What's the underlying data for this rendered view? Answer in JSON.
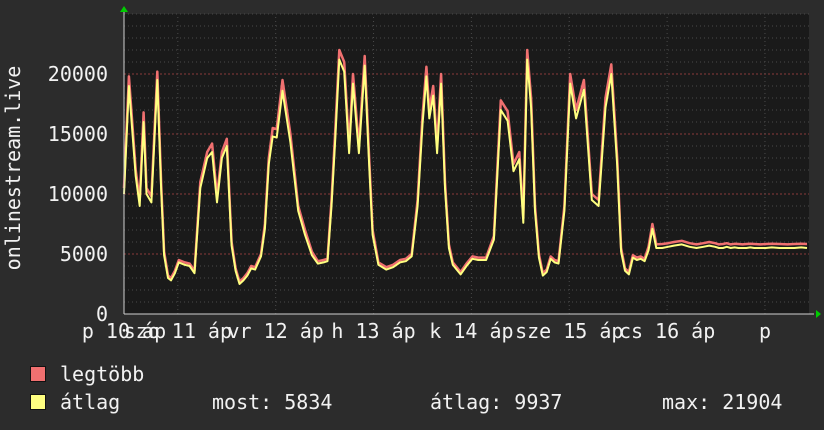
{
  "colors": {
    "background": "#2c2c2c",
    "plot_bg": "#1a1a1a",
    "grid": "#4a4a4a",
    "max_series": "#f07070",
    "avg_series": "#ffff80",
    "axis_arrow": "#00cc00",
    "text": "#f2f2f2"
  },
  "chart_data": {
    "type": "area",
    "ylabel": "onlinestream.live",
    "ylim": [
      0,
      25000
    ],
    "yticks": [
      0,
      5000,
      10000,
      15000,
      20000
    ],
    "ytick_labels": [
      "0",
      "5000",
      "10000",
      "15000",
      "20000"
    ],
    "xlim": [
      0,
      7
    ],
    "xticks": [
      {
        "x": 0.0,
        "label": "p 10 áp"
      },
      {
        "x": 0.55,
        "label": "szo 11 áp"
      },
      {
        "x": 1.55,
        "label": "vr 12 áp"
      },
      {
        "x": 2.55,
        "label": "h 13 áp"
      },
      {
        "x": 3.55,
        "label": "k 14 áp"
      },
      {
        "x": 4.55,
        "label": "sze 15 áp"
      },
      {
        "x": 5.55,
        "label": "cs 16 áp"
      },
      {
        "x": 6.55,
        "label": "p"
      }
    ],
    "x": [
      0.0,
      0.05,
      0.12,
      0.16,
      0.2,
      0.23,
      0.28,
      0.34,
      0.38,
      0.41,
      0.45,
      0.48,
      0.52,
      0.56,
      0.62,
      0.67,
      0.72,
      0.78,
      0.85,
      0.9,
      0.95,
      1.0,
      1.05,
      1.1,
      1.14,
      1.18,
      1.22,
      1.26,
      1.3,
      1.34,
      1.4,
      1.44,
      1.48,
      1.52,
      1.56,
      1.62,
      1.7,
      1.78,
      1.85,
      1.92,
      1.98,
      2.04,
      2.08,
      2.12,
      2.16,
      2.2,
      2.25,
      2.3,
      2.34,
      2.4,
      2.46,
      2.5,
      2.54,
      2.6,
      2.68,
      2.75,
      2.82,
      2.88,
      2.94,
      3.0,
      3.05,
      3.09,
      3.12,
      3.16,
      3.2,
      3.24,
      3.28,
      3.32,
      3.36,
      3.4,
      3.44,
      3.5,
      3.56,
      3.62,
      3.7,
      3.78,
      3.85,
      3.92,
      3.98,
      4.04,
      4.08,
      4.12,
      4.16,
      4.2,
      4.24,
      4.28,
      4.32,
      4.36,
      4.4,
      4.44,
      4.5,
      4.56,
      4.62,
      4.7,
      4.78,
      4.85,
      4.92,
      4.98,
      5.04,
      5.08,
      5.12,
      5.16,
      5.2,
      5.24,
      5.28,
      5.32,
      5.36,
      5.4,
      5.44,
      5.5,
      5.56,
      5.62,
      5.7,
      5.78,
      5.85,
      5.92,
      5.98,
      6.04,
      6.08,
      6.12,
      6.16,
      6.2,
      6.24,
      6.28,
      6.32,
      6.36,
      6.4,
      6.44,
      6.5,
      6.56,
      6.62,
      6.7,
      6.78,
      6.85,
      6.92,
      6.98
    ],
    "series": [
      {
        "name": "legtöbb",
        "values": [
          10500,
          19800,
          12000,
          9500,
          16800,
          10500,
          9800,
          20200,
          10800,
          5200,
          3200,
          3000,
          3600,
          4500,
          4300,
          4200,
          3600,
          11000,
          13500,
          14200,
          9800,
          13500,
          14600,
          6000,
          3800,
          2700,
          3000,
          3400,
          4000,
          3900,
          5000,
          7500,
          13000,
          15500,
          15400,
          19500,
          15000,
          9000,
          7000,
          5200,
          4400,
          4500,
          4600,
          9500,
          15500,
          22000,
          21000,
          14000,
          20000,
          14000,
          21500,
          14000,
          7000,
          4300,
          3900,
          4100,
          4500,
          4600,
          5000,
          9500,
          16500,
          20600,
          17000,
          19000,
          14000,
          20000,
          11000,
          5800,
          4300,
          3900,
          3500,
          4200,
          4800,
          4700,
          4700,
          6500,
          17800,
          16900,
          12500,
          13500,
          8000,
          22000,
          18000,
          9000,
          5000,
          3400,
          3700,
          4800,
          4500,
          4400,
          9000,
          20000,
          17000,
          19500,
          10000,
          9500,
          18000,
          20800,
          13000,
          5500,
          3800,
          3500,
          4900,
          4700,
          4800,
          4600,
          5600,
          7500,
          5800,
          5834,
          5900,
          6000,
          6100,
          5900,
          5800,
          5900,
          6000,
          5900,
          5800,
          5834,
          5900,
          5800,
          5850,
          5834,
          5800,
          5834,
          5850,
          5834,
          5800,
          5834,
          5850,
          5834,
          5800,
          5834,
          5850,
          5834
        ]
      },
      {
        "name": "átlag",
        "values": [
          10000,
          19000,
          11500,
          9000,
          16000,
          10000,
          9300,
          19500,
          10300,
          4900,
          3000,
          2800,
          3400,
          4300,
          4100,
          4000,
          3400,
          10500,
          13000,
          13500,
          9300,
          13000,
          14000,
          5700,
          3600,
          2500,
          2800,
          3200,
          3800,
          3700,
          4800,
          7100,
          12500,
          14800,
          14700,
          18600,
          14300,
          8600,
          6600,
          4900,
          4200,
          4300,
          4400,
          9000,
          14800,
          21200,
          20200,
          13400,
          19200,
          13400,
          20700,
          13400,
          6600,
          4100,
          3700,
          3900,
          4300,
          4400,
          4800,
          9000,
          15800,
          19800,
          16300,
          18200,
          13400,
          19200,
          10500,
          5500,
          4100,
          3700,
          3300,
          4000,
          4600,
          4500,
          4500,
          6200,
          17000,
          16100,
          11900,
          12900,
          7600,
          21200,
          17200,
          8600,
          4700,
          3200,
          3500,
          4600,
          4300,
          4200,
          8600,
          19200,
          16300,
          18700,
          9500,
          9000,
          17200,
          20000,
          12400,
          5200,
          3600,
          3300,
          4700,
          4500,
          4600,
          4400,
          5300,
          7100,
          5500,
          5500,
          5600,
          5700,
          5800,
          5600,
          5500,
          5600,
          5700,
          5600,
          5500,
          5500,
          5600,
          5500,
          5550,
          5500,
          5500,
          5500,
          5550,
          5500,
          5500,
          5500,
          5550,
          5500,
          5500,
          5500,
          5550,
          5500
        ]
      }
    ],
    "legend": [
      {
        "label": "legtöbb",
        "color": "#f07070"
      },
      {
        "label": "átlag",
        "color": "#ffff80"
      }
    ],
    "grid": true
  },
  "stats": {
    "most": "most: 5834",
    "atlag": "átlag: 9937",
    "max": "max: 21904"
  }
}
